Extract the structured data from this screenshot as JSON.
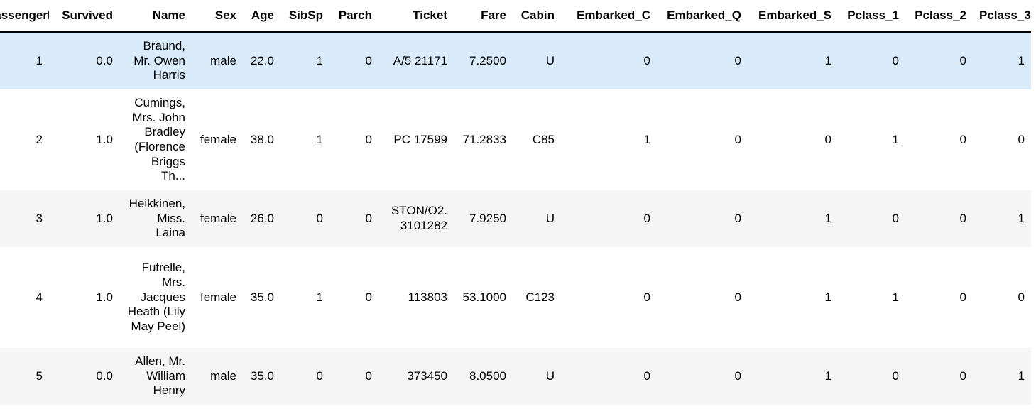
{
  "table": {
    "headers": [
      "PassengerId",
      "Survived",
      "Name",
      "Sex",
      "Age",
      "SibSp",
      "Parch",
      "Ticket",
      "Fare",
      "Cabin",
      "Embarked_C",
      "Embarked_Q",
      "Embarked_S",
      "Pclass_1",
      "Pclass_2",
      "Pclass_3"
    ],
    "rows": [
      [
        "1",
        "0.0",
        "Braund, Mr. Owen Harris",
        "male",
        "22.0",
        "1",
        "0",
        "A/5 21171",
        "7.2500",
        "U",
        "0",
        "0",
        "1",
        "0",
        "0",
        "1"
      ],
      [
        "2",
        "1.0",
        "Cumings, Mrs. John Bradley (Florence Briggs Th...",
        "female",
        "38.0",
        "1",
        "0",
        "PC 17599",
        "71.2833",
        "C85",
        "1",
        "0",
        "0",
        "1",
        "0",
        "0"
      ],
      [
        "3",
        "1.0",
        "Heikkinen, Miss. Laina",
        "female",
        "26.0",
        "0",
        "0",
        "STON/O2. 3101282",
        "7.9250",
        "U",
        "0",
        "0",
        "1",
        "0",
        "0",
        "1"
      ],
      [
        "4",
        "1.0",
        "Futrelle, Mrs. Jacques Heath (Lily May Peel)",
        "female",
        "35.0",
        "1",
        "0",
        "113803",
        "53.1000",
        "C123",
        "0",
        "0",
        "1",
        "1",
        "0",
        "0"
      ],
      [
        "5",
        "0.0",
        "Allen, Mr. William Henry",
        "male",
        "35.0",
        "0",
        "0",
        "373450",
        "8.0500",
        "U",
        "0",
        "0",
        "1",
        "0",
        "0",
        "1"
      ]
    ]
  },
  "colors": {
    "header_border": "#000000",
    "row_stripe": "#f5f5f5",
    "row_hover": "#d9ebfa"
  }
}
